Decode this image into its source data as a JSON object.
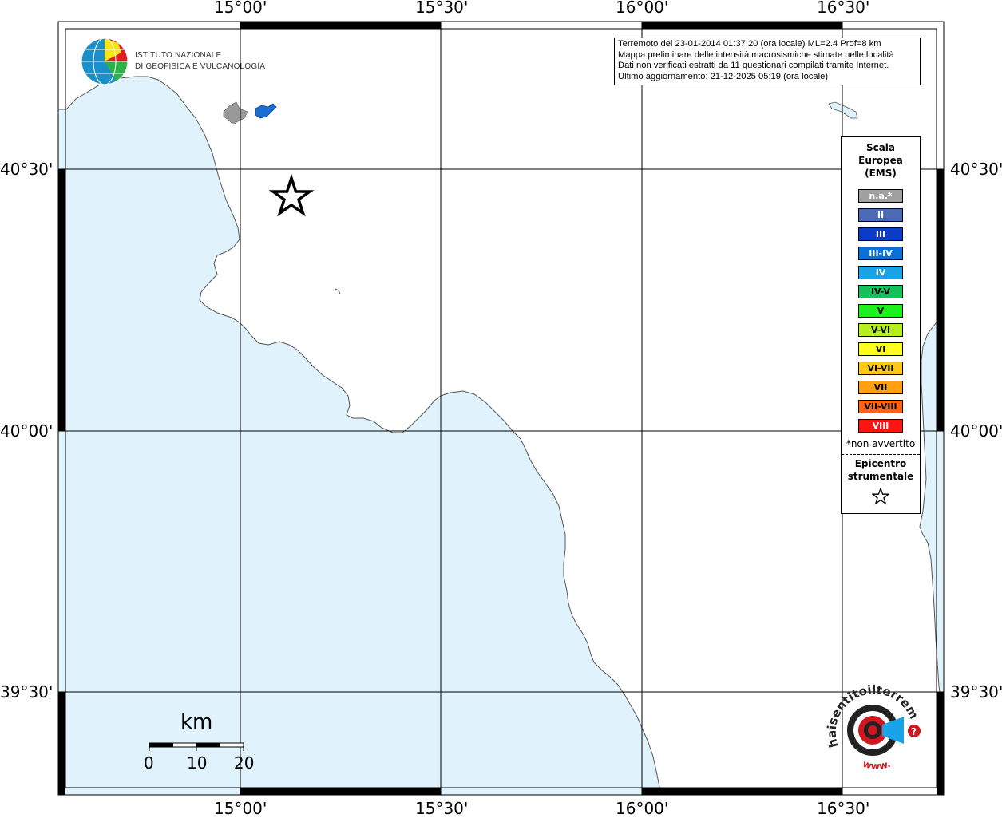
{
  "map": {
    "colors": {
      "sea": "#e0f2fc",
      "land": "#ffffff",
      "coast": "#555555",
      "grid": "#000000"
    },
    "lon_labels": [
      "15°00'",
      "15°30'",
      "16°00'",
      "16°30'"
    ],
    "lat_labels": [
      "40°30'",
      "40°00'",
      "39°30'"
    ],
    "epicenter_icon": "star-icon"
  },
  "info": {
    "line1": "Terremoto del 23-01-2014 01:37:20 (ora locale) ML=2.4 Prof=8 km",
    "line2": "Mappa preliminare delle intensità macrosismiche stimate nelle località",
    "line3": "Dati non verificati estratti da 11 questionari compilati tramite Internet.",
    "line4": "Ultimo aggiornamento: 21-12-2025 05:19 (ora locale)"
  },
  "logo_ingv": {
    "line1": "ISTITUTO NAZIONALE",
    "line2": "DI GEOFISICA E VULCANOLOGIA"
  },
  "legend": {
    "title1": "Scala",
    "title2": "Europea",
    "title3": "(EMS)",
    "items": [
      {
        "label": "n.a.*",
        "color": "#a0a0a0",
        "text": "#ffffff"
      },
      {
        "label": "II",
        "color": "#4b6bb5",
        "text": "#ffffff"
      },
      {
        "label": "III",
        "color": "#0a3cc8",
        "text": "#ffffff"
      },
      {
        "label": "III-IV",
        "color": "#0a6fd6",
        "text": "#ffffff"
      },
      {
        "label": "IV",
        "color": "#1aa3e6",
        "text": "#ffffff"
      },
      {
        "label": "IV-V",
        "color": "#16c05a",
        "text": "#000000"
      },
      {
        "label": "V",
        "color": "#1ef01e",
        "text": "#000000"
      },
      {
        "label": "V-VI",
        "color": "#b4f01e",
        "text": "#000000"
      },
      {
        "label": "VI",
        "color": "#ffff1e",
        "text": "#000000"
      },
      {
        "label": "VI-VII",
        "color": "#ffc814",
        "text": "#000000"
      },
      {
        "label": "VII",
        "color": "#ffa014",
        "text": "#000000"
      },
      {
        "label": "VII-VIII",
        "color": "#ff6414",
        "text": "#000000"
      },
      {
        "label": "VIII",
        "color": "#ff1414",
        "text": "#ffffff"
      }
    ],
    "note": "*non avvertito",
    "epi1": "Epicentro",
    "epi2": "strumentale"
  },
  "scalebar": {
    "unit": "km",
    "ticks": [
      "0",
      "10",
      "20"
    ]
  },
  "logo_hsit": {
    "top_text": "haisentitoilterremoto.it",
    "bottom_text": "www."
  }
}
